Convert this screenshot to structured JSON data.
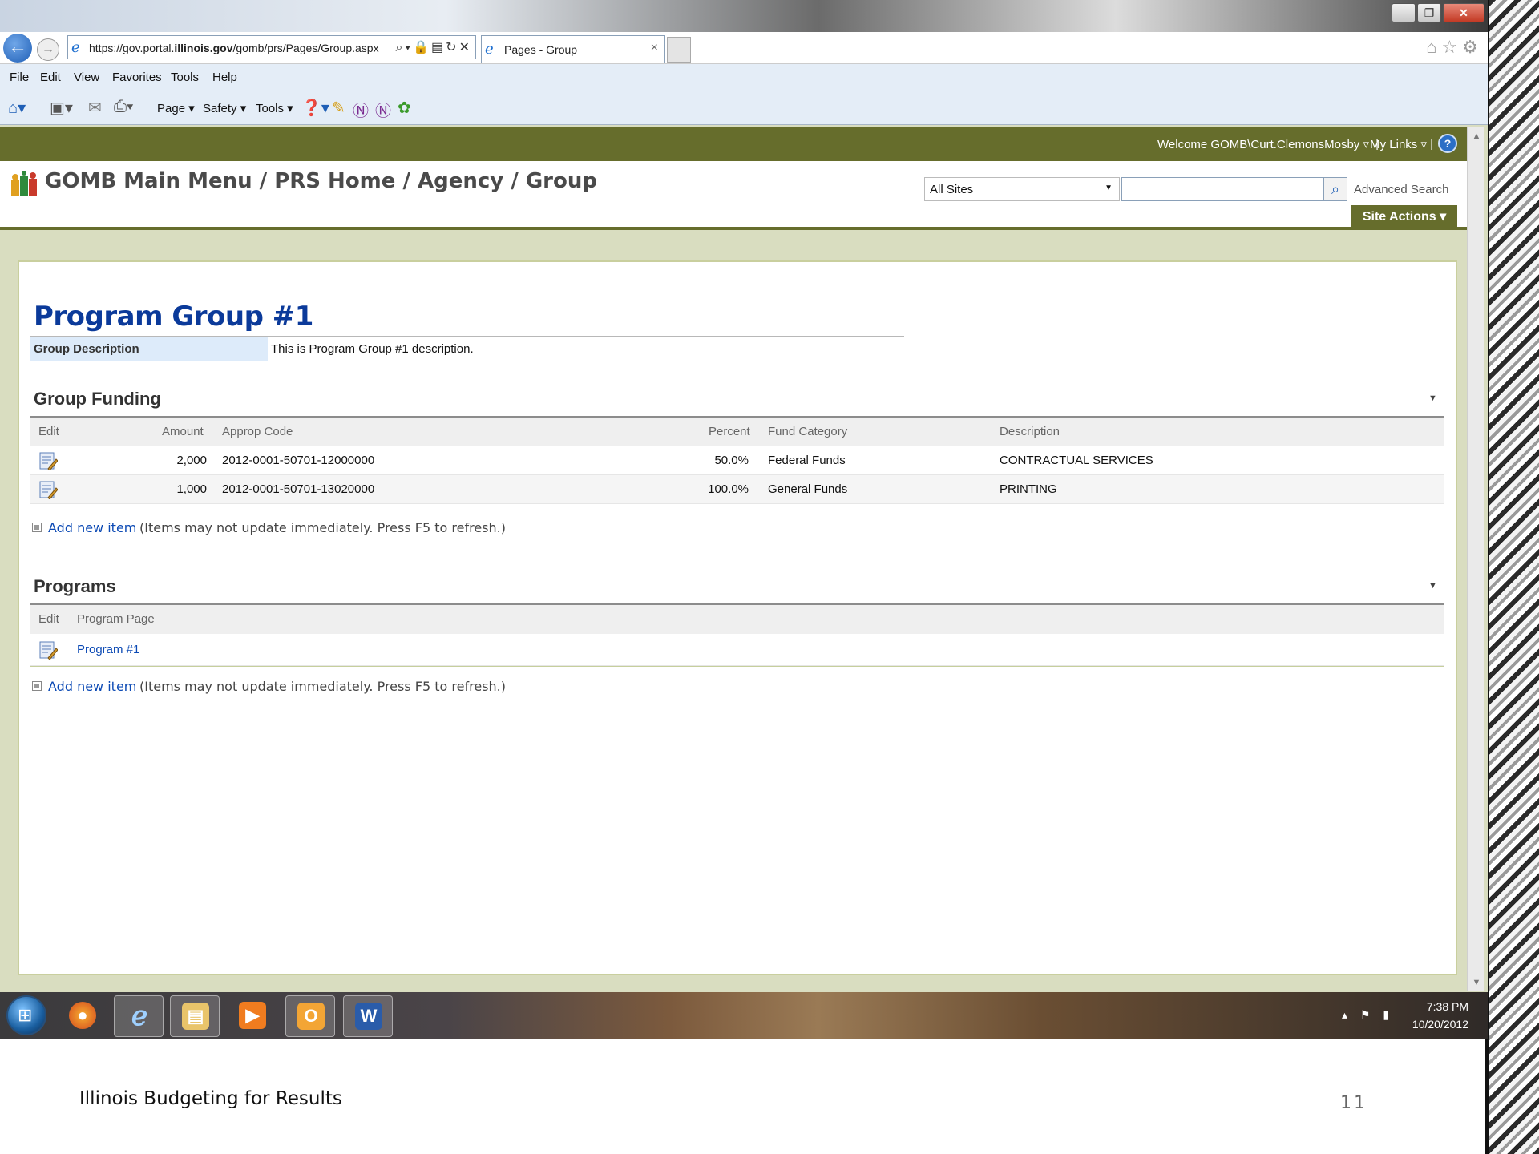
{
  "browser": {
    "address": {
      "prefix": "https://gov.portal.",
      "domain": "illinois.gov",
      "path": "/gomb/prs/Pages/Group.aspx"
    },
    "tab_label": "Pages - Group",
    "menu": [
      "File",
      "Edit",
      "View",
      "Favorites",
      "Tools",
      "Help"
    ],
    "commands": {
      "page": "Page ▾",
      "safety": "Safety ▾",
      "tools": "Tools ▾"
    }
  },
  "sharepoint": {
    "welcome": "Welcome GOMB\\Curt.ClemonsMosby ▿",
    "my_links": "My Links ▿",
    "breadcrumb": "GOMB Main Menu / PRS Home  / Agency / Group",
    "search_scope": "All Sites",
    "advanced_search": "Advanced Search",
    "site_actions": "Site Actions ▾"
  },
  "page": {
    "title": "Program Group #1",
    "description_label": "Group Description",
    "description_value": "This is Program Group #1 description."
  },
  "group_funding": {
    "title": "Group Funding",
    "columns": {
      "edit": "Edit",
      "amount": "Amount",
      "approp_code": "Approp Code",
      "percent": "Percent",
      "fund_category": "Fund Category",
      "description": "Description"
    },
    "rows": [
      {
        "amount": "2,000",
        "approp_code": "2012-0001-50701-12000000",
        "percent": "50.0%",
        "fund_category": "Federal Funds",
        "description": "CONTRACTUAL SERVICES"
      },
      {
        "amount": "1,000",
        "approp_code": "2012-0001-50701-13020000",
        "percent": "100.0%",
        "fund_category": "General Funds",
        "description": "PRINTING"
      }
    ],
    "add_link": "Add new item",
    "add_note": "(Items may not update immediately. Press F5 to refresh.)"
  },
  "programs": {
    "title": "Programs",
    "columns": {
      "edit": "Edit",
      "program_page": "Program Page"
    },
    "rows": [
      {
        "program_page": "Program #1"
      }
    ],
    "add_link": "Add new item",
    "add_note": "(Items may not update immediately. Press F5 to refresh.)"
  },
  "taskbar": {
    "time": "7:38 PM",
    "date": "10/20/2012",
    "apps": [
      "firefox-icon",
      "internet-explorer-icon",
      "file-explorer-icon",
      "media-player-icon",
      "outlook-icon",
      "word-icon"
    ]
  },
  "slide": {
    "footer": "Illinois Budgeting for Results",
    "number": "11"
  },
  "colors": {
    "sharepoint_olive": "#666d2c",
    "title_blue": "#0b3a9a",
    "link_blue": "#0b49b4"
  }
}
